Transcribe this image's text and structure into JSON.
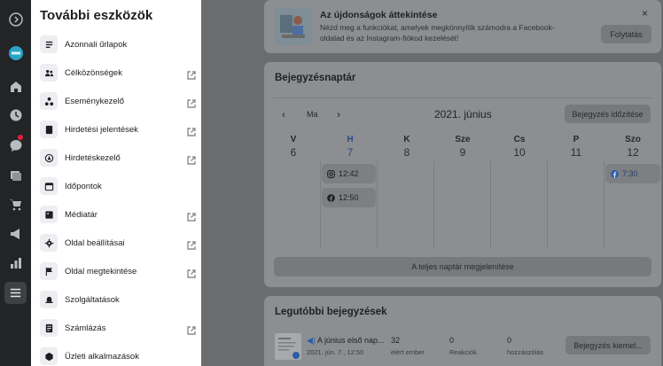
{
  "drawer": {
    "title": "További eszközök",
    "items": [
      {
        "label": "Azonnali űrlapok",
        "icon": "form-icon",
        "external": false
      },
      {
        "label": "Célközönségek",
        "icon": "audience-icon",
        "external": true
      },
      {
        "label": "Eseménykezelő",
        "icon": "events-icon",
        "external": true
      },
      {
        "label": "Hirdetési jelentések",
        "icon": "report-icon",
        "external": true
      },
      {
        "label": "Hirdetéskezelő",
        "icon": "ads-manager-icon",
        "external": true
      },
      {
        "label": "Időpontok",
        "icon": "calendar-icon",
        "external": false
      },
      {
        "label": "Médiatár",
        "icon": "media-icon",
        "external": true
      },
      {
        "label": "Oldal beállításai",
        "icon": "gear-icon",
        "external": true
      },
      {
        "label": "Oldal megtekintése",
        "icon": "flag-icon",
        "external": true
      },
      {
        "label": "Szolgáltatások",
        "icon": "bell-icon",
        "external": false
      },
      {
        "label": "Számlázás",
        "icon": "billing-icon",
        "external": true
      },
      {
        "label": "Üzleti alkalmazások",
        "icon": "cube-icon",
        "external": false
      }
    ]
  },
  "banner": {
    "title": "Az újdonságok áttekintése",
    "text": "Nézd meg a funkciókat, amelyek megkönnyítik számodra a Facebook-oldalad és az Instagram-fiókod kezelését!",
    "button": "Folytatás",
    "close": "×"
  },
  "calendar": {
    "title": "Bejegyzésnaptár",
    "today_label": "Ma",
    "month": "2021. június",
    "schedule_button": "Bejegyzés időzítése",
    "days": [
      {
        "name": "V",
        "num": "6"
      },
      {
        "name": "H",
        "num": "7"
      },
      {
        "name": "K",
        "num": "8"
      },
      {
        "name": "Sze",
        "num": "9"
      },
      {
        "name": "Cs",
        "num": "10"
      },
      {
        "name": "P",
        "num": "11"
      },
      {
        "name": "Szo",
        "num": "12"
      }
    ],
    "events": [
      {
        "time": "12:42",
        "platform": "instagram"
      },
      {
        "time": "12:50",
        "platform": "facebook"
      },
      {
        "time": "7:30",
        "platform": "facebook"
      }
    ],
    "show_all": "A teljes naptár megjelenítése"
  },
  "recent": {
    "title": "Legutóbbi bejegyzések",
    "post_title": "A június első nap...",
    "post_date": "2021. jún. 7., 12:50",
    "reach_value": "32",
    "reach_label": "elért ember",
    "reactions_value": "0",
    "reactions_label": "Reakciók",
    "comments_value": "0",
    "comments_label": "hozzászólás",
    "boost_button": "Bejegyzés kiemel..."
  },
  "colors": {
    "accent": "#1877f2",
    "rail": "#232425",
    "drawer": "#ffffff"
  }
}
